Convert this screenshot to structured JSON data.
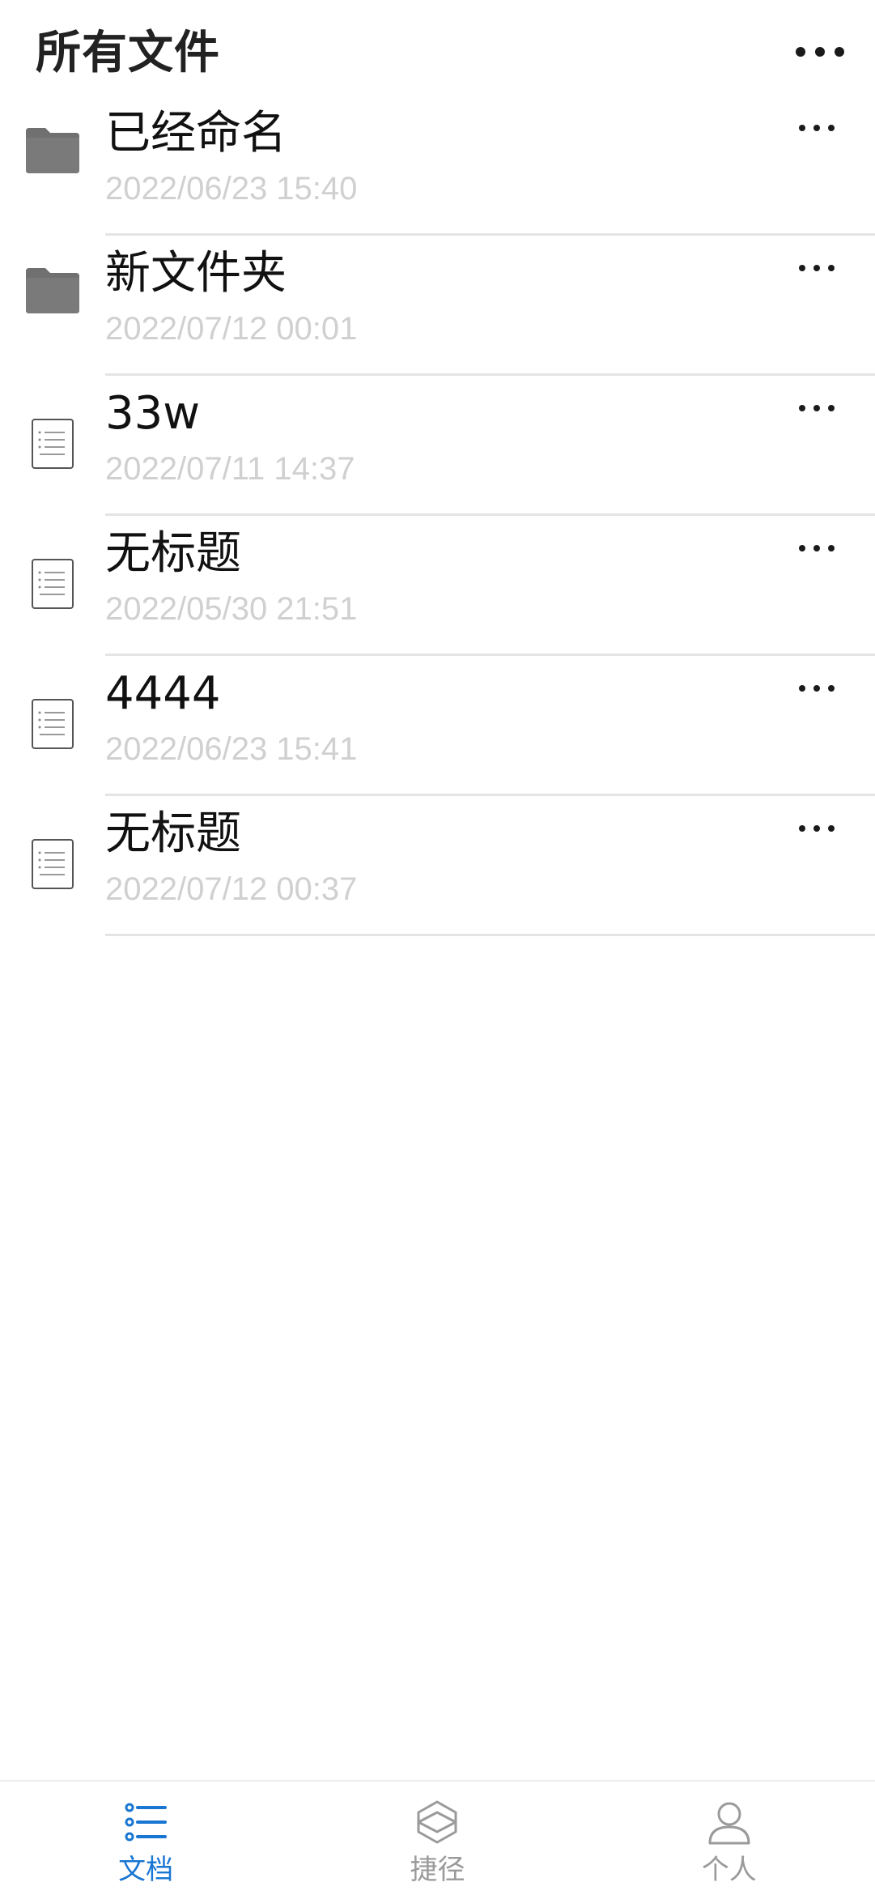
{
  "header": {
    "title": "所有文件"
  },
  "files": [
    {
      "name": "已经命名",
      "date": "2022/06/23 15:40",
      "type": "folder"
    },
    {
      "name": "新文件夹",
      "date": "2022/07/12 00:01",
      "type": "folder"
    },
    {
      "name": "33w",
      "date": "2022/07/11 14:37",
      "type": "document"
    },
    {
      "name": "无标题",
      "date": "2022/05/30 21:51",
      "type": "document"
    },
    {
      "name": "4444",
      "date": "2022/06/23 15:41",
      "type": "document"
    },
    {
      "name": "无标题",
      "date": "2022/07/12 00:37",
      "type": "document"
    }
  ],
  "tabbar": {
    "tabs": [
      {
        "label": "文档",
        "icon": "list-icon",
        "active": true
      },
      {
        "label": "捷径",
        "icon": "cube-icon",
        "active": false
      },
      {
        "label": "个人",
        "icon": "person-icon",
        "active": false
      }
    ]
  },
  "colors": {
    "accent": "#1976d2",
    "inactive": "#9a9a9a",
    "date_text": "#d0d0d0",
    "folder": "#707070"
  }
}
